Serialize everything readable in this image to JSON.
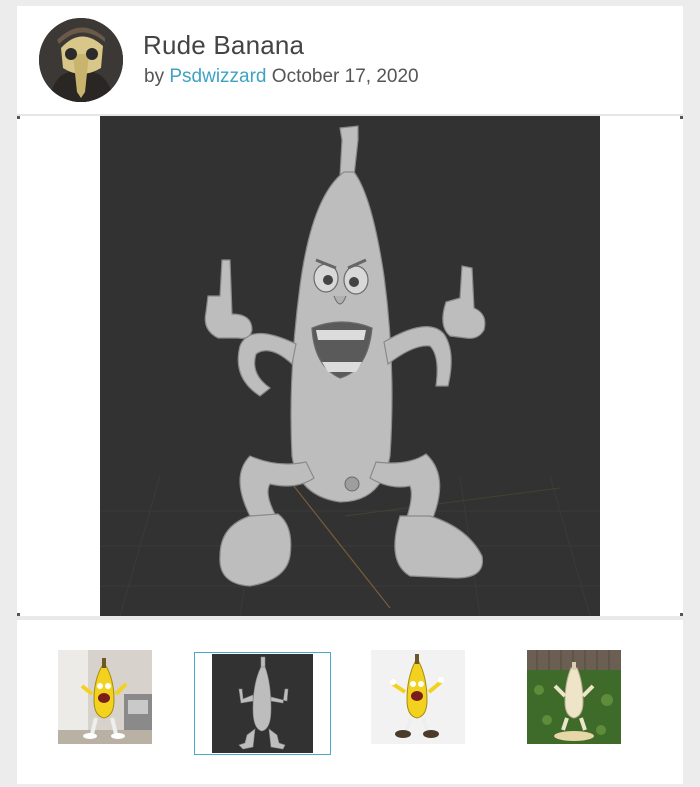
{
  "post": {
    "title": "Rude Banana",
    "by_prefix": "by",
    "author": "Psdwizzard",
    "date": "October 17, 2020"
  },
  "avatar": {
    "icon": "plague-doctor-mask-avatar"
  },
  "main_image": {
    "icon": "banana-3d-model-render",
    "background": "#323232"
  },
  "thumbnails": [
    {
      "icon": "painted-banana-print-photo",
      "selected": false
    },
    {
      "icon": "banana-3d-model-render",
      "selected": true
    },
    {
      "icon": "painted-banana-white-background",
      "selected": false
    },
    {
      "icon": "banana-print-in-grass",
      "selected": false
    }
  ],
  "colors": {
    "accent_link": "#3ea2c4",
    "selected_border": "#4aa8c9",
    "viewer_background": "#323232",
    "banana_yellow": "#f2d21e"
  }
}
